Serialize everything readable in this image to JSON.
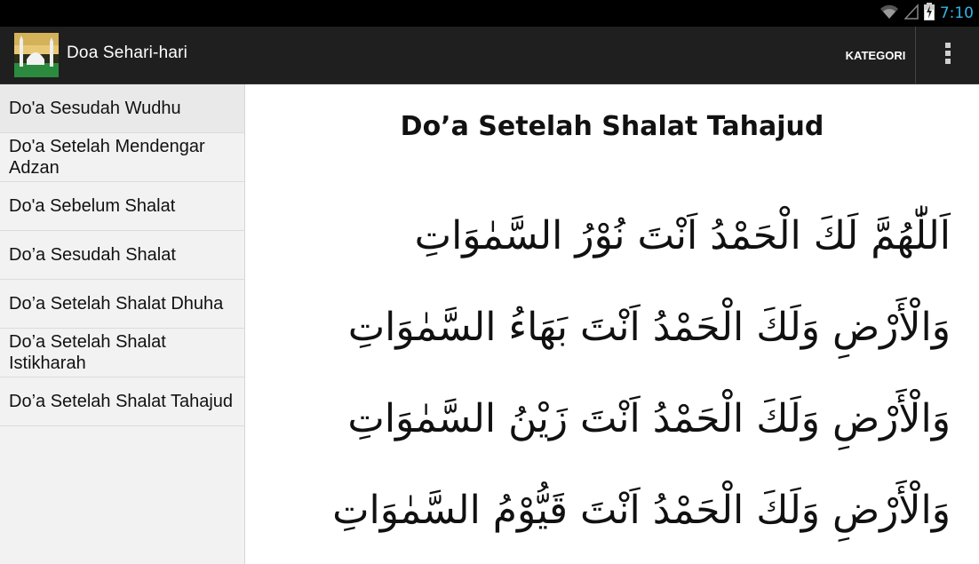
{
  "status_bar": {
    "time": "7:10",
    "icons": [
      "wifi-icon",
      "signal-icon",
      "battery-charging-icon"
    ],
    "accent_color": "#33b5e5"
  },
  "action_bar": {
    "title": "Doa Sehari-hari",
    "kategori_label": "KATEGORI",
    "overflow_icon": "overflow-menu-icon",
    "app_icon": "mosque-icon"
  },
  "sidebar": {
    "items": [
      {
        "label": "Do'a Sesudah Wudhu"
      },
      {
        "label": "Do'a Setelah Mendengar Adzan"
      },
      {
        "label": "Do'a Sebelum Shalat"
      },
      {
        "label": "Do’a Sesudah Shalat"
      },
      {
        "label": "Do’a Setelah Shalat Dhuha"
      },
      {
        "label": "Do’a Setelah Shalat Istikharah"
      },
      {
        "label": "Do’a Setelah Shalat Tahajud"
      }
    ]
  },
  "content": {
    "title": "Do’a Setelah Shalat Tahajud",
    "arabic_lines": [
      "اَللّٰهُمَّ لَكَ الْحَمْدُ اَنْتَ نُوْرُ السَّمٰوَاتِ",
      "وَالْأَرْضِ وَلَكَ الْحَمْدُ اَنْتَ بَهَاءُ السَّمٰوَاتِ",
      "وَالْأَرْضِ وَلَكَ الْحَمْدُ اَنْتَ زَيْنُ السَّمٰوَاتِ",
      "وَالْأَرْضِ وَلَكَ الْحَمْدُ اَنْتَ قَيُّوْمُ السَّمٰوَاتِ"
    ]
  }
}
